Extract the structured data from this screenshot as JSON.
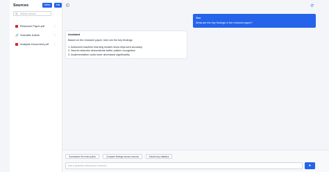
{
  "sidebar": {
    "title": "Sources",
    "action_label": "Action",
    "add_label": "Add",
    "search_placeholder": "Search sources...",
    "sources": [
      {
        "label": "Research Paper.pdf",
        "type": "pdf",
        "menu": "⋮"
      },
      {
        "label": "Scientific Article",
        "type": "link",
        "menu": "⋮"
      },
      {
        "label": "Analysis Document.pdf",
        "type": "pdf",
        "menu": "⋮"
      }
    ]
  },
  "chat": {
    "user": {
      "name": "You",
      "message": "What are the key findings in the research paper?"
    },
    "assistant": {
      "name": "Assistant",
      "intro": "Based on the research paper, here are the key findings:",
      "findings": [
        "1. Advanced machine learning models show improved accuracy",
        "2. Neural networks demonstrate better pattern recognition",
        "3. Implementation costs have decreased significantly"
      ]
    }
  },
  "suggestions": [
    "Summarize the main points",
    "Compare findings across sources",
    "Extract key statistics"
  ],
  "composer": {
    "placeholder": "Ask a question about your sources...",
    "send_icon": "➤"
  },
  "icons": {
    "sidebar_toggle": "panel-toggle-icon",
    "refresh": "refresh-icon",
    "search": "search-icon"
  },
  "colors": {
    "accent": "#2563eb",
    "pdf": "#dc2626",
    "background": "#f3f5f9"
  }
}
